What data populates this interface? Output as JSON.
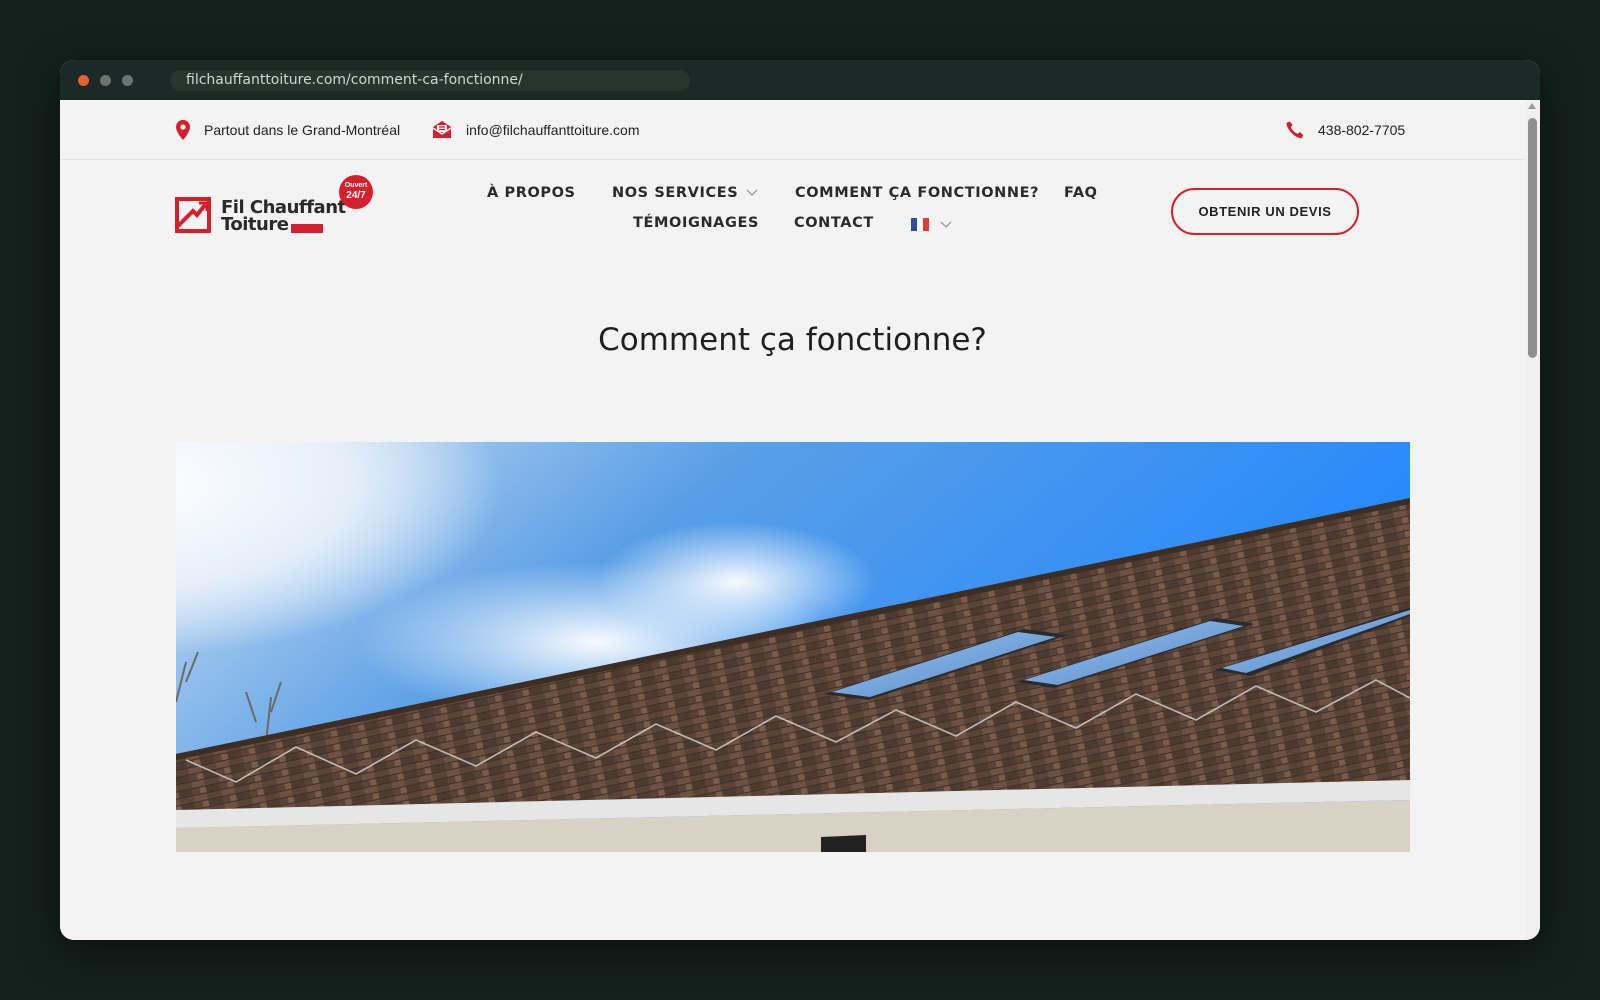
{
  "browser": {
    "url": "filchauffanttoiture.com/comment-ca-fonctionne/",
    "dots": [
      "#e8612c",
      "#6b7470",
      "#6b7470"
    ]
  },
  "topbar": {
    "location": "Partout dans le Grand-Montréal",
    "email": "info@filchauffanttoiture.com",
    "phone": "438-802-7705"
  },
  "logo": {
    "line1": "Fil Chauffant",
    "line2": "Toiture",
    "badge_small": "Ouvert",
    "badge_big": "24/7"
  },
  "nav": {
    "items": [
      {
        "label": "À PROPOS"
      },
      {
        "label": "NOS SERVICES"
      },
      {
        "label": "COMMENT ÇA FONCTIONNE?"
      },
      {
        "label": "FAQ"
      },
      {
        "label": "TÉMOIGNAGES"
      },
      {
        "label": "CONTACT"
      }
    ],
    "language_icon": "french-flag-icon",
    "cta": "OBTENIR UN DEVIS"
  },
  "page": {
    "title": "Comment ça fonctionne?"
  },
  "colors": {
    "brand_red": "#d61f2c",
    "page_bg": "#f3f3f3",
    "frame_bg": "#14211d"
  }
}
